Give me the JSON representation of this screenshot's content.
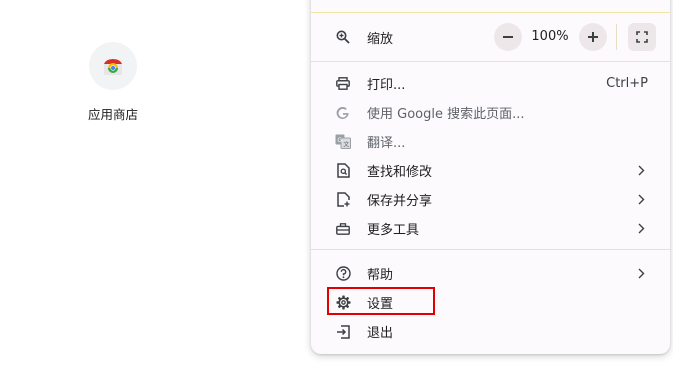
{
  "new_tab": {
    "app_shortcut_label": "应用商店"
  },
  "menu": {
    "zoom": {
      "label": "缩放",
      "value": "100%",
      "decrease_symbol": "−",
      "increase_symbol": "+"
    },
    "print": {
      "label": "打印...",
      "shortcut": "Ctrl+P"
    },
    "search_page": {
      "label": "使用 Google 搜索此页面..."
    },
    "translate": {
      "label": "翻译..."
    },
    "find_edit": {
      "label": "查找和修改"
    },
    "save_share": {
      "label": "保存并分享"
    },
    "more_tools": {
      "label": "更多工具"
    },
    "help": {
      "label": "帮助"
    },
    "settings": {
      "label": "设置"
    },
    "exit": {
      "label": "退出"
    }
  },
  "colors": {
    "menu_background": "#fcfafd",
    "separator": "#f3e3a5",
    "highlight": "#e00000",
    "icon": "#3c4043"
  }
}
